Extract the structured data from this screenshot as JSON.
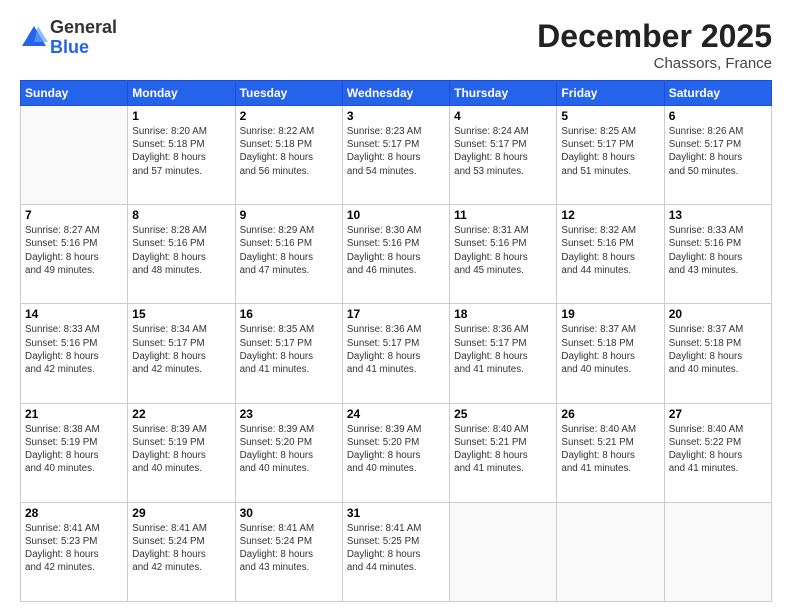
{
  "header": {
    "logo_general": "General",
    "logo_blue": "Blue",
    "month_title": "December 2025",
    "location": "Chassors, France"
  },
  "days_of_week": [
    "Sunday",
    "Monday",
    "Tuesday",
    "Wednesday",
    "Thursday",
    "Friday",
    "Saturday"
  ],
  "weeks": [
    [
      {
        "day": "",
        "info": ""
      },
      {
        "day": "1",
        "info": "Sunrise: 8:20 AM\nSunset: 5:18 PM\nDaylight: 8 hours\nand 57 minutes."
      },
      {
        "day": "2",
        "info": "Sunrise: 8:22 AM\nSunset: 5:18 PM\nDaylight: 8 hours\nand 56 minutes."
      },
      {
        "day": "3",
        "info": "Sunrise: 8:23 AM\nSunset: 5:17 PM\nDaylight: 8 hours\nand 54 minutes."
      },
      {
        "day": "4",
        "info": "Sunrise: 8:24 AM\nSunset: 5:17 PM\nDaylight: 8 hours\nand 53 minutes."
      },
      {
        "day": "5",
        "info": "Sunrise: 8:25 AM\nSunset: 5:17 PM\nDaylight: 8 hours\nand 51 minutes."
      },
      {
        "day": "6",
        "info": "Sunrise: 8:26 AM\nSunset: 5:17 PM\nDaylight: 8 hours\nand 50 minutes."
      }
    ],
    [
      {
        "day": "7",
        "info": "Sunrise: 8:27 AM\nSunset: 5:16 PM\nDaylight: 8 hours\nand 49 minutes."
      },
      {
        "day": "8",
        "info": "Sunrise: 8:28 AM\nSunset: 5:16 PM\nDaylight: 8 hours\nand 48 minutes."
      },
      {
        "day": "9",
        "info": "Sunrise: 8:29 AM\nSunset: 5:16 PM\nDaylight: 8 hours\nand 47 minutes."
      },
      {
        "day": "10",
        "info": "Sunrise: 8:30 AM\nSunset: 5:16 PM\nDaylight: 8 hours\nand 46 minutes."
      },
      {
        "day": "11",
        "info": "Sunrise: 8:31 AM\nSunset: 5:16 PM\nDaylight: 8 hours\nand 45 minutes."
      },
      {
        "day": "12",
        "info": "Sunrise: 8:32 AM\nSunset: 5:16 PM\nDaylight: 8 hours\nand 44 minutes."
      },
      {
        "day": "13",
        "info": "Sunrise: 8:33 AM\nSunset: 5:16 PM\nDaylight: 8 hours\nand 43 minutes."
      }
    ],
    [
      {
        "day": "14",
        "info": "Sunrise: 8:33 AM\nSunset: 5:16 PM\nDaylight: 8 hours\nand 42 minutes."
      },
      {
        "day": "15",
        "info": "Sunrise: 8:34 AM\nSunset: 5:17 PM\nDaylight: 8 hours\nand 42 minutes."
      },
      {
        "day": "16",
        "info": "Sunrise: 8:35 AM\nSunset: 5:17 PM\nDaylight: 8 hours\nand 41 minutes."
      },
      {
        "day": "17",
        "info": "Sunrise: 8:36 AM\nSunset: 5:17 PM\nDaylight: 8 hours\nand 41 minutes."
      },
      {
        "day": "18",
        "info": "Sunrise: 8:36 AM\nSunset: 5:17 PM\nDaylight: 8 hours\nand 41 minutes."
      },
      {
        "day": "19",
        "info": "Sunrise: 8:37 AM\nSunset: 5:18 PM\nDaylight: 8 hours\nand 40 minutes."
      },
      {
        "day": "20",
        "info": "Sunrise: 8:37 AM\nSunset: 5:18 PM\nDaylight: 8 hours\nand 40 minutes."
      }
    ],
    [
      {
        "day": "21",
        "info": "Sunrise: 8:38 AM\nSunset: 5:19 PM\nDaylight: 8 hours\nand 40 minutes."
      },
      {
        "day": "22",
        "info": "Sunrise: 8:39 AM\nSunset: 5:19 PM\nDaylight: 8 hours\nand 40 minutes."
      },
      {
        "day": "23",
        "info": "Sunrise: 8:39 AM\nSunset: 5:20 PM\nDaylight: 8 hours\nand 40 minutes."
      },
      {
        "day": "24",
        "info": "Sunrise: 8:39 AM\nSunset: 5:20 PM\nDaylight: 8 hours\nand 40 minutes."
      },
      {
        "day": "25",
        "info": "Sunrise: 8:40 AM\nSunset: 5:21 PM\nDaylight: 8 hours\nand 41 minutes."
      },
      {
        "day": "26",
        "info": "Sunrise: 8:40 AM\nSunset: 5:21 PM\nDaylight: 8 hours\nand 41 minutes."
      },
      {
        "day": "27",
        "info": "Sunrise: 8:40 AM\nSunset: 5:22 PM\nDaylight: 8 hours\nand 41 minutes."
      }
    ],
    [
      {
        "day": "28",
        "info": "Sunrise: 8:41 AM\nSunset: 5:23 PM\nDaylight: 8 hours\nand 42 minutes."
      },
      {
        "day": "29",
        "info": "Sunrise: 8:41 AM\nSunset: 5:24 PM\nDaylight: 8 hours\nand 42 minutes."
      },
      {
        "day": "30",
        "info": "Sunrise: 8:41 AM\nSunset: 5:24 PM\nDaylight: 8 hours\nand 43 minutes."
      },
      {
        "day": "31",
        "info": "Sunrise: 8:41 AM\nSunset: 5:25 PM\nDaylight: 8 hours\nand 44 minutes."
      },
      {
        "day": "",
        "info": ""
      },
      {
        "day": "",
        "info": ""
      },
      {
        "day": "",
        "info": ""
      }
    ]
  ]
}
